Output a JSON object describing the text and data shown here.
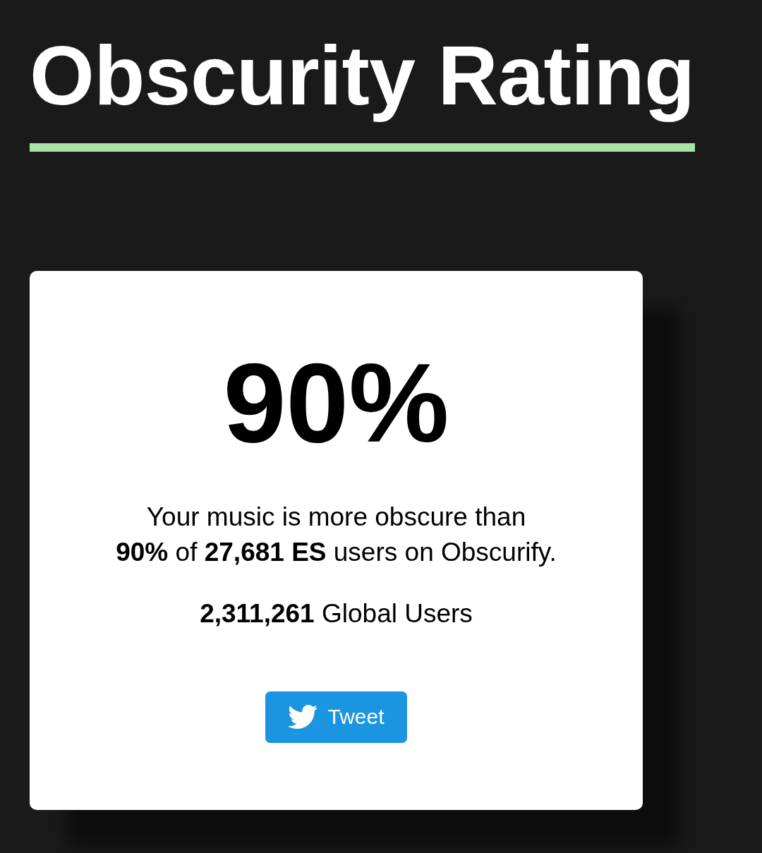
{
  "title": "Obscurity Rating",
  "rating_card": {
    "percent": "90%",
    "summary": "Your music is more obscure than\n**90%** of **27,681 ES** users on Obscurify.",
    "global_users": "**2,311,261** Global Users",
    "tweet_button": {
      "label": "Tweet"
    }
  }
}
